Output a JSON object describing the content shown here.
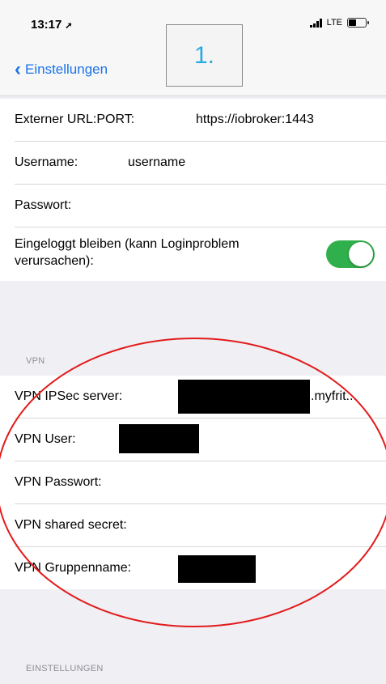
{
  "status_bar": {
    "time": "13:17",
    "carrier": "LTE"
  },
  "nav": {
    "back_label": "Einstellungen",
    "step_label": "1."
  },
  "server_section": {
    "external_url_label": "Externer URL:PORT:",
    "external_url_value": "https://iobroker:1443",
    "username_label": "Username:",
    "username_value": "username",
    "password_label": "Passwort:",
    "stay_logged_in_label_1": "Eingeloggt bleiben (kann Loginproblem",
    "stay_logged_in_label_2": "verursachen):",
    "stay_logged_in_enabled": true
  },
  "vpn_section": {
    "header": "VPN",
    "ipsec_label": "VPN IPSec server:",
    "ipsec_value_suffix": ".myfrit...",
    "user_label": "VPN User:",
    "password_label": "VPN Passwort:",
    "shared_secret_label": "VPN shared secret:",
    "group_label": "VPN Gruppenname:"
  },
  "settings_section": {
    "header": "EINSTELLUNGEN"
  },
  "colors": {
    "accent": "#1a73e8",
    "toggle_on": "#30b04c",
    "annotation": "#e21b1b",
    "step_text": "#29a9e1"
  },
  "icons": {
    "back": "chevron-left-icon",
    "location": "location-arrow-icon"
  }
}
